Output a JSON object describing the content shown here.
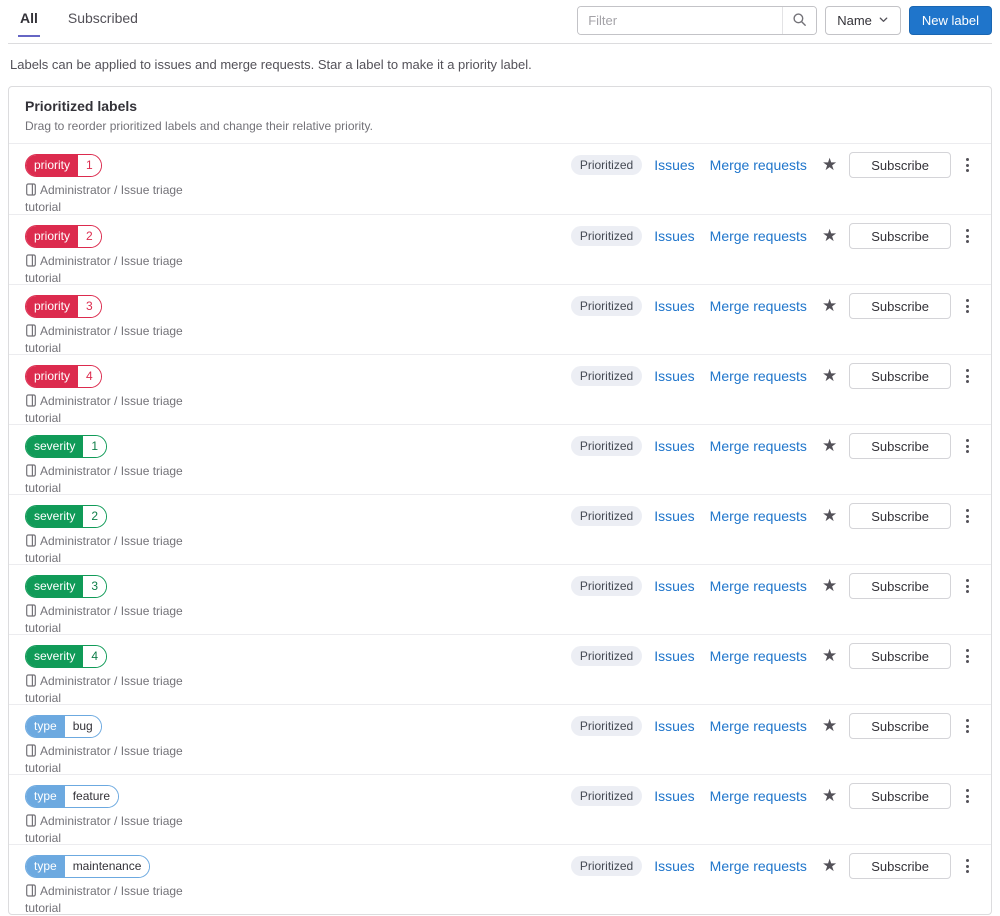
{
  "tabs": {
    "all": "All",
    "subscribed": "Subscribed"
  },
  "toolbar": {
    "filter_placeholder": "Filter",
    "sort_button": "Name",
    "new_label_button": "New label"
  },
  "page_description": "Labels can be applied to issues and merge requests. Star a label to make it a priority label.",
  "prioritized_card": {
    "title": "Prioritized labels",
    "subtitle": "Drag to reorder prioritized labels and change their relative priority."
  },
  "row_common": {
    "project_path": "Administrator / Issue triage tutorial",
    "prioritized_badge": "Prioritized",
    "issues_link": "Issues",
    "merge_requests_link": "Merge requests",
    "subscribe_button": "Subscribe"
  },
  "labels": [
    {
      "key": "priority",
      "value": "1",
      "color": "#dc2b4e",
      "value_text": "#dc2b4e"
    },
    {
      "key": "priority",
      "value": "2",
      "color": "#dc2b4e",
      "value_text": "#dc2b4e"
    },
    {
      "key": "priority",
      "value": "3",
      "color": "#dc2b4e",
      "value_text": "#dc2b4e"
    },
    {
      "key": "priority",
      "value": "4",
      "color": "#dc2b4e",
      "value_text": "#dc2b4e"
    },
    {
      "key": "severity",
      "value": "1",
      "color": "#109b58",
      "value_text": "#0e7d48"
    },
    {
      "key": "severity",
      "value": "2",
      "color": "#109b58",
      "value_text": "#0e7d48"
    },
    {
      "key": "severity",
      "value": "3",
      "color": "#109b58",
      "value_text": "#0e7d48"
    },
    {
      "key": "severity",
      "value": "4",
      "color": "#109b58",
      "value_text": "#0e7d48"
    },
    {
      "key": "type",
      "value": "bug",
      "color": "#6ca9e0",
      "value_text": "#333238"
    },
    {
      "key": "type",
      "value": "feature",
      "color": "#6ca9e0",
      "value_text": "#333238"
    },
    {
      "key": "type",
      "value": "maintenance",
      "color": "#6ca9e0",
      "value_text": "#333238"
    }
  ],
  "icons": {
    "search": "magnifier",
    "chevron_down": "chevron-down",
    "star": "★",
    "kebab": "vertical-ellipsis",
    "project": "project-outline"
  },
  "colors": {
    "accent_blue": "#1f75cb",
    "tab_indicator": "#6666c4",
    "label_red": "#dc2b4e",
    "label_green": "#109b58",
    "label_blue": "#6ca9e0",
    "badge_bg": "#eceef4"
  }
}
